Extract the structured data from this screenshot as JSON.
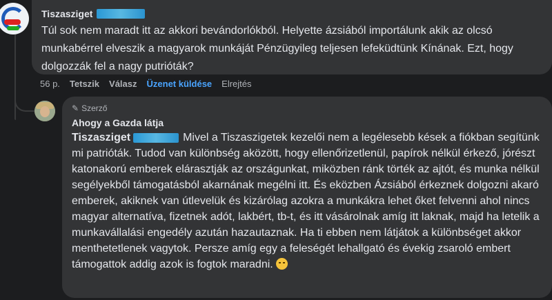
{
  "comment": {
    "author": "Tiszasziget",
    "text": "Túl sok nem maradt itt az akkori bevándorlókból. Helyette ázsiából importálunk akik az olcsó munkabérrel elveszik a magyarok munkáját Pénzügyileg teljesen lefeküdtünk Kínának. Ezt, hogy dolgozzák fel a nagy putrióták?",
    "time": "56 p.",
    "like": "Tetszik",
    "reply": "Válasz",
    "send_message": "Üzenet küldése",
    "hide": "Elrejtés"
  },
  "reply": {
    "badge": "Szerző",
    "author": "Ahogy a Gazda látja",
    "mention": "Tiszasziget",
    "text": "Mivel a Tiszaszigetek kezelői nem a legélesebb kések a fiókban segítünk mi patrióták. Tudod van különbség aközött, hogy ellenőrizetlenül, papírok nélkül érkező, jórészt katonakorú emberek elárasztják az országunkat, miközben ránk törték az ajtót, és munka nélkül segélyekből támogatásból akarnának megélni itt. És eközben Ázsiából érkeznek dolgozni akaró emberek, akiknek van útlevelük és kizárólag azokra a munkákra lehet őket felvenni ahol nincs magyar alternatíva, fizetnek adót, lakbért, tb-t, és itt vásárolnak amíg itt laknak, majd ha letelik a munkavállalási engedély azután hazautaznak. Ha ti ebben nem látjátok a különbséget akkor menthetetlenek vagytok. Persze amíg egy a feleségét lehallgató és évekig zsaroló embert támogattok addig azok is fogtok maradni."
  },
  "icons": {
    "badge_icon": "pencil-icon",
    "emoji": "wink-emoji-icon"
  }
}
